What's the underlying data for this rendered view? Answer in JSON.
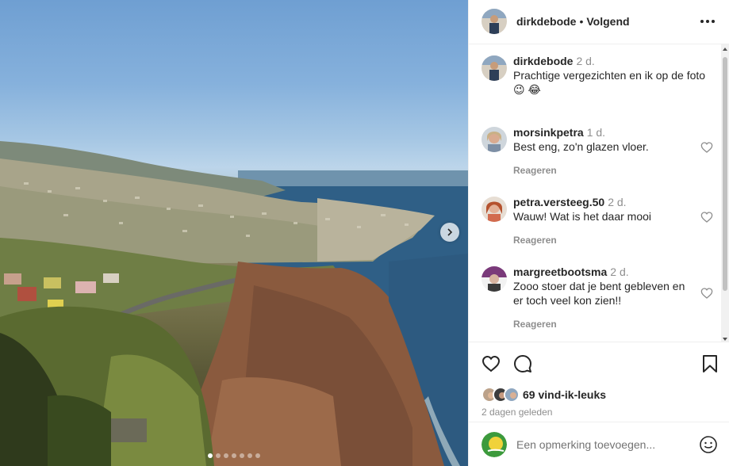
{
  "post": {
    "author": "dirkdebode",
    "separator": "•",
    "follow_label": "Volgend",
    "caption": {
      "username": "dirkdebode",
      "time": "2 d.",
      "text": "Prachtige vergezichten en ik op de foto",
      "emojis": "😉 😂"
    },
    "comments": [
      {
        "username": "morsinkpetra",
        "time": "1 d.",
        "text": "Best eng, zo'n glazen vloer.",
        "reply": "Reageren"
      },
      {
        "username": "petra.versteeg.50",
        "time": "2 d.",
        "text": "Wauw! Wat is het daar mooi",
        "reply": "Reageren"
      },
      {
        "username": "margreetbootsma",
        "time": "2 d.",
        "text": "Zooo stoer dat je bent gebleven en er toch veel kon zien!!",
        "reply": "Reageren"
      }
    ],
    "likes_text": "69 vind-ik-leuks",
    "date_text": "2 dagen geleden",
    "comment_placeholder": "Een opmerking toevoegen..."
  },
  "carousel": {
    "count": 7,
    "active_index": 0
  },
  "icons": {
    "more": "more-horizontal-icon",
    "like": "heart-icon",
    "comment": "comment-bubble-icon",
    "save": "bookmark-icon",
    "next": "chevron-right-icon",
    "emoji": "smiley-icon"
  },
  "colors": {
    "text": "#262626",
    "muted": "#8e8e8e",
    "border": "#efefef"
  }
}
